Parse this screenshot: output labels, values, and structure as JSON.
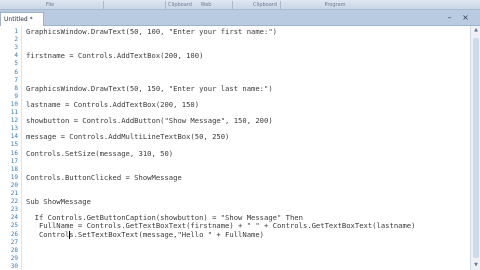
{
  "ribbon": {
    "groups": [
      "File",
      "Clipboard",
      "Web",
      "Clipboard",
      "Program"
    ]
  },
  "tab": {
    "title": "Untitled *"
  },
  "window": {
    "minimize": "–",
    "close": "×"
  },
  "editor": {
    "line_numbers": [
      "1",
      "2",
      "3",
      "4",
      "5",
      "6",
      "7",
      "8",
      "9",
      "10",
      "11",
      "12",
      "13",
      "14",
      "15",
      "16",
      "17",
      "18",
      "19",
      "20",
      "21",
      "22",
      "23",
      "24",
      "25",
      "26",
      "27",
      "28",
      "29",
      "30"
    ],
    "lines": [
      "GraphicsWindow.DrawText(50, 100, \"Enter your first name:\")",
      "",
      "",
      "firstname = Controls.AddTextBox(200, 100)",
      "",
      "",
      "",
      "GraphicsWindow.DrawText(50, 150, \"Enter your last name:\")",
      "",
      "lastname = Controls.AddTextBox(200, 150)",
      "",
      "showbutton = Controls.AddButton(\"Show Message\", 150, 200)",
      "",
      "message = Controls.AddMultiLineTextBox(50, 250)",
      "",
      "Controls.SetSize(message, 310, 50)",
      "",
      "",
      "Controls.ButtonClicked = ShowMessage",
      "",
      "",
      "Sub ShowMessage",
      "",
      "  If Controls.GetButtonCaption(showbutton) = \"Show Message\" Then",
      "   FullName = Controls.GetTextBoxText(firstname) + \" \" + Controls.GetTextBoxText(lastname)",
      "   Controls.SetTextBoxText(message,\"Hello \" + FullName)"
    ]
  },
  "scrollbar": {
    "up": "▲",
    "down": "▼"
  }
}
